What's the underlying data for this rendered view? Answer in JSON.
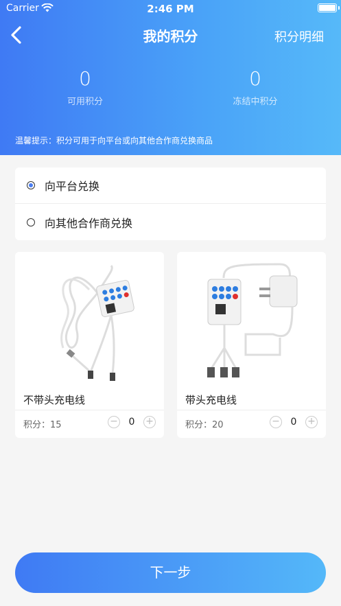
{
  "status": {
    "carrier": "Carrier",
    "time": "2:46 PM"
  },
  "nav": {
    "title": "我的积分",
    "detail": "积分明细"
  },
  "stats": {
    "available": {
      "value": "0",
      "label": "可用积分"
    },
    "frozen": {
      "value": "0",
      "label": "冻结中积分"
    }
  },
  "tip": "温馨提示：积分可用于向平台或向其他合作商兑换商品",
  "options": [
    {
      "label": "向平台兑换",
      "selected": true
    },
    {
      "label": "向其他合作商兑换",
      "selected": false
    }
  ],
  "products": [
    {
      "name": "不带头充电线",
      "points": "积分：15",
      "qty": "0"
    },
    {
      "name": "带头充电线",
      "points": "积分：20",
      "qty": "0"
    }
  ],
  "next_label": "下一步",
  "colors": {
    "accent": "#3f7af4",
    "accent_end": "#54b8f9"
  }
}
